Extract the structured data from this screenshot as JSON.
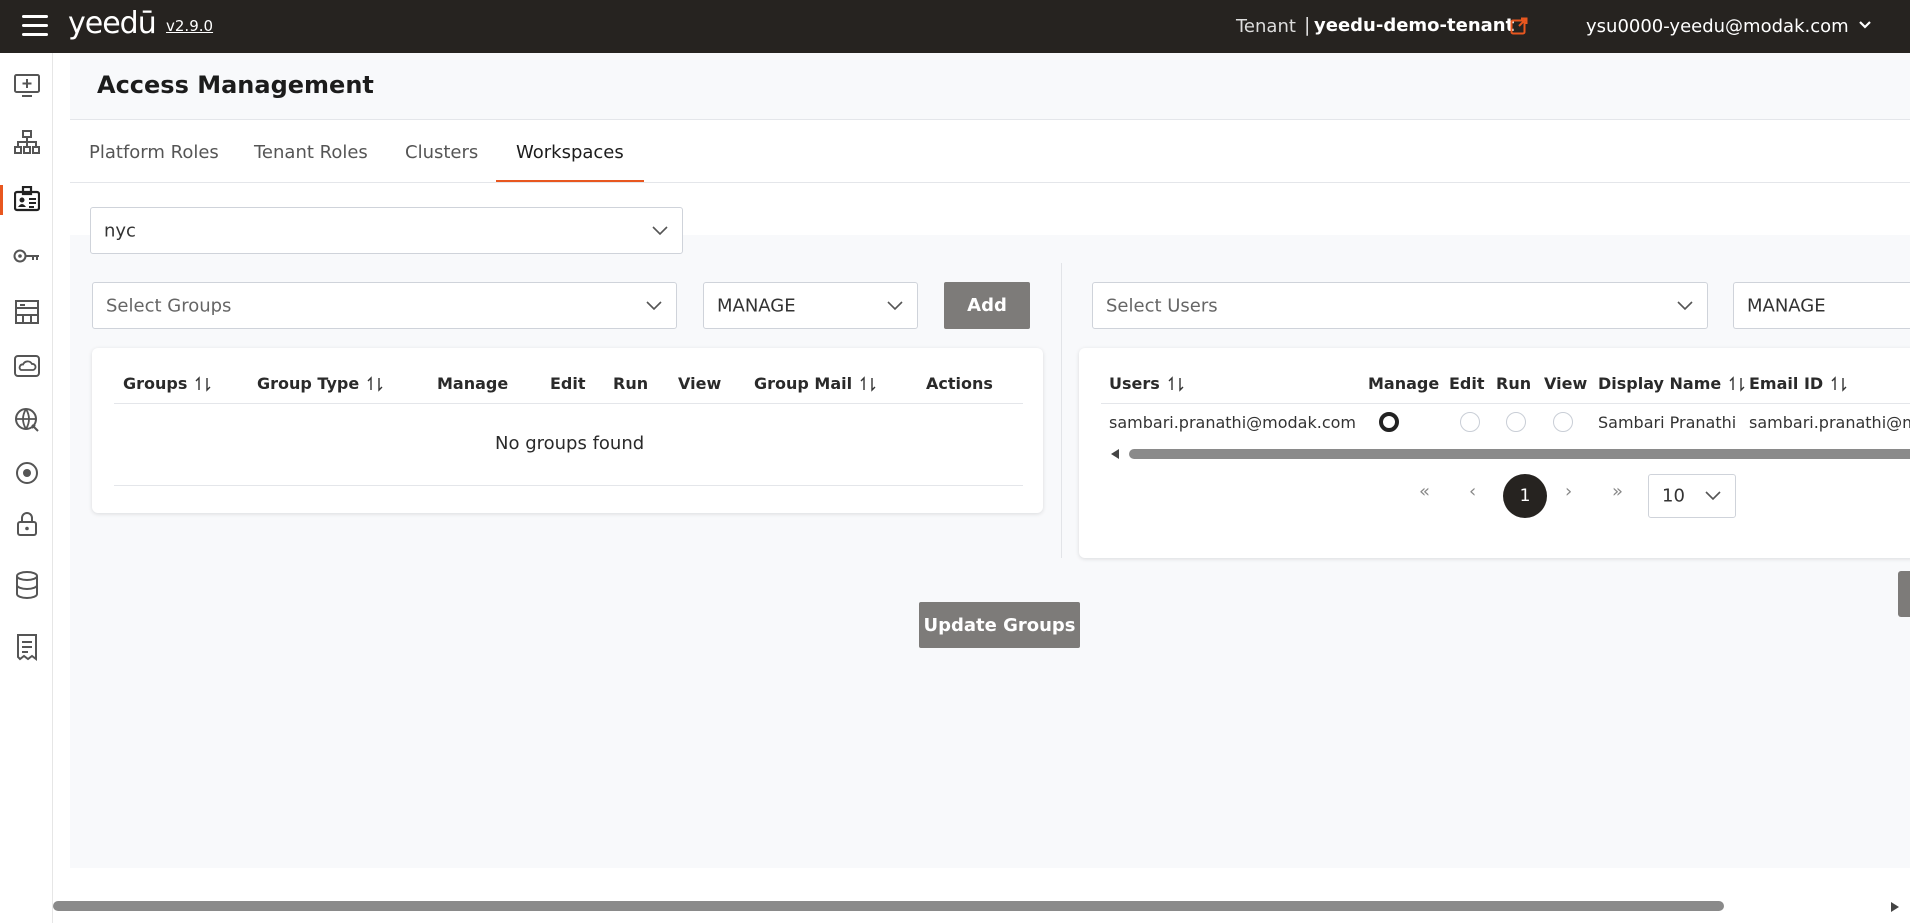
{
  "header": {
    "logo_text": "yeedū",
    "version": "v2.9.0",
    "tenant_label": "Tenant",
    "tenant_separator": "|",
    "tenant_name": "yeedu-demo-tenant",
    "user_email": "ysu0000-yeedu@modak.com",
    "bg_color": "#262320",
    "accent_color": "#e8571f"
  },
  "sidebar": {
    "items": [
      {
        "icon": "monitor-plus-icon"
      },
      {
        "icon": "sitemap-icon"
      },
      {
        "icon": "id-card-icon",
        "active": true
      },
      {
        "icon": "key-icon"
      },
      {
        "icon": "building-icon"
      },
      {
        "icon": "cloud-icon"
      },
      {
        "icon": "globe-icon"
      },
      {
        "icon": "target-icon"
      },
      {
        "icon": "lock-icon"
      },
      {
        "icon": "database-icon"
      },
      {
        "icon": "receipt-icon"
      }
    ]
  },
  "page": {
    "title": "Access Management",
    "tabs": [
      {
        "label": "Platform Roles"
      },
      {
        "label": "Tenant Roles"
      },
      {
        "label": "Clusters"
      },
      {
        "label": "Workspaces",
        "active": true
      }
    ],
    "workspace_select": "nyc"
  },
  "groups_panel": {
    "select_placeholder": "Select Groups",
    "permission_select": "MANAGE",
    "add_label": "Add",
    "columns": [
      "Groups",
      "Group Type",
      "Manage",
      "Edit",
      "Run",
      "View",
      "Group Mail",
      "Actions"
    ],
    "empty_message": "No groups found",
    "update_label": "Update Groups"
  },
  "users_panel": {
    "select_placeholder": "Select Users",
    "permission_select": "MANAGE",
    "columns": [
      "Users",
      "Manage",
      "Edit",
      "Run",
      "View",
      "Display Name",
      "Email ID"
    ],
    "rows": [
      {
        "user": "sambari.pranathi@modak.com",
        "manage": true,
        "edit": false,
        "run": false,
        "view": false,
        "display_name": "Sambari Pranathi",
        "email_id": "sambari.pranathi@modak.com"
      }
    ],
    "pagination": {
      "first": "«",
      "prev": "‹",
      "current_page": "1",
      "next": "›",
      "last": "»",
      "page_size": "10"
    }
  }
}
